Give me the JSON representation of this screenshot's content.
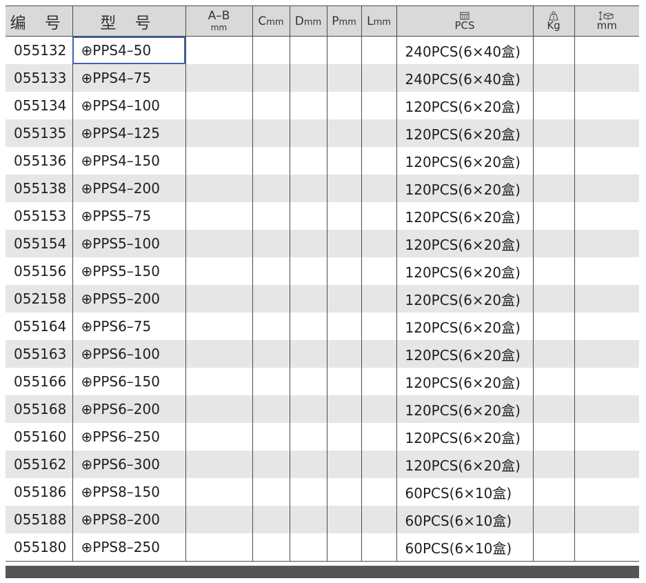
{
  "headers": {
    "code": "编 号",
    "model": "型 号",
    "ab_main": "A–B",
    "ab_unit": "mm",
    "c_main": "C",
    "c_unit": "mm",
    "d_main": "D",
    "d_unit": "mm",
    "p_main": "P",
    "p_unit": "mm",
    "l_main": "L",
    "l_unit": "mm",
    "pack_unit": "PCS",
    "weight_unit": "Kg",
    "size_unit": "mm"
  },
  "icons": {
    "pack": "box-icon",
    "weight": "weight-icon",
    "size": "carton-dimension-icon",
    "model_prefix": "phillips-cross-icon"
  },
  "model_prefix": "⊕",
  "rows": [
    {
      "code": "055132",
      "model": "PPS4–50",
      "ab": "",
      "c": "",
      "d": "",
      "p": "",
      "l": "",
      "pack": "240PCS(6×40盒)",
      "kg": "",
      "mm": ""
    },
    {
      "code": "055133",
      "model": "PPS4–75",
      "ab": "",
      "c": "",
      "d": "",
      "p": "",
      "l": "",
      "pack": "240PCS(6×40盒)",
      "kg": "",
      "mm": ""
    },
    {
      "code": "055134",
      "model": "PPS4–100",
      "ab": "",
      "c": "",
      "d": "",
      "p": "",
      "l": "",
      "pack": "120PCS(6×20盒)",
      "kg": "",
      "mm": ""
    },
    {
      "code": "055135",
      "model": "PPS4–125",
      "ab": "",
      "c": "",
      "d": "",
      "p": "",
      "l": "",
      "pack": "120PCS(6×20盒)",
      "kg": "",
      "mm": ""
    },
    {
      "code": "055136",
      "model": "PPS4–150",
      "ab": "",
      "c": "",
      "d": "",
      "p": "",
      "l": "",
      "pack": "120PCS(6×20盒)",
      "kg": "",
      "mm": ""
    },
    {
      "code": "055138",
      "model": "PPS4–200",
      "ab": "",
      "c": "",
      "d": "",
      "p": "",
      "l": "",
      "pack": "120PCS(6×20盒)",
      "kg": "",
      "mm": ""
    },
    {
      "code": "055153",
      "model": "PPS5–75",
      "ab": "",
      "c": "",
      "d": "",
      "p": "",
      "l": "",
      "pack": "120PCS(6×20盒)",
      "kg": "",
      "mm": ""
    },
    {
      "code": "055154",
      "model": "PPS5–100",
      "ab": "",
      "c": "",
      "d": "",
      "p": "",
      "l": "",
      "pack": "120PCS(6×20盒)",
      "kg": "",
      "mm": ""
    },
    {
      "code": "055156",
      "model": "PPS5–150",
      "ab": "",
      "c": "",
      "d": "",
      "p": "",
      "l": "",
      "pack": "120PCS(6×20盒)",
      "kg": "",
      "mm": ""
    },
    {
      "code": "052158",
      "model": "PPS5–200",
      "ab": "",
      "c": "",
      "d": "",
      "p": "",
      "l": "",
      "pack": "120PCS(6×20盒)",
      "kg": "",
      "mm": ""
    },
    {
      "code": "055164",
      "model": "PPS6–75",
      "ab": "",
      "c": "",
      "d": "",
      "p": "",
      "l": "",
      "pack": "120PCS(6×20盒)",
      "kg": "",
      "mm": ""
    },
    {
      "code": "055163",
      "model": "PPS6–100",
      "ab": "",
      "c": "",
      "d": "",
      "p": "",
      "l": "",
      "pack": "120PCS(6×20盒)",
      "kg": "",
      "mm": ""
    },
    {
      "code": "055166",
      "model": "PPS6–150",
      "ab": "",
      "c": "",
      "d": "",
      "p": "",
      "l": "",
      "pack": "120PCS(6×20盒)",
      "kg": "",
      "mm": ""
    },
    {
      "code": "055168",
      "model": "PPS6–200",
      "ab": "",
      "c": "",
      "d": "",
      "p": "",
      "l": "",
      "pack": "120PCS(6×20盒)",
      "kg": "",
      "mm": ""
    },
    {
      "code": "055160",
      "model": "PPS6–250",
      "ab": "",
      "c": "",
      "d": "",
      "p": "",
      "l": "",
      "pack": "120PCS(6×20盒)",
      "kg": "",
      "mm": ""
    },
    {
      "code": "055162",
      "model": "PPS6–300",
      "ab": "",
      "c": "",
      "d": "",
      "p": "",
      "l": "",
      "pack": "120PCS(6×20盒)",
      "kg": "",
      "mm": ""
    },
    {
      "code": "055186",
      "model": "PPS8–150",
      "ab": "",
      "c": "",
      "d": "",
      "p": "",
      "l": "",
      "pack": "60PCS(6×10盒)",
      "kg": "",
      "mm": ""
    },
    {
      "code": "055188",
      "model": "PPS8–200",
      "ab": "",
      "c": "",
      "d": "",
      "p": "",
      "l": "",
      "pack": "60PCS(6×10盒)",
      "kg": "",
      "mm": ""
    },
    {
      "code": "055180",
      "model": "PPS8–250",
      "ab": "",
      "c": "",
      "d": "",
      "p": "",
      "l": "",
      "pack": "60PCS(6×10盒)",
      "kg": "",
      "mm": ""
    }
  ]
}
